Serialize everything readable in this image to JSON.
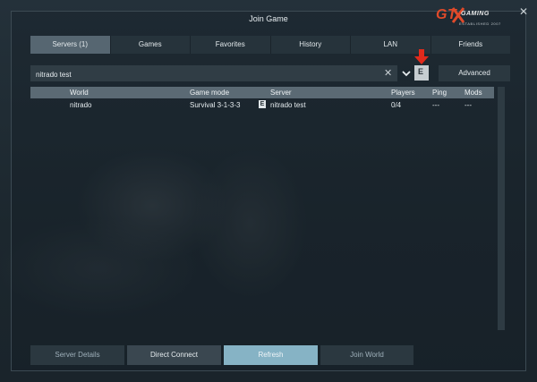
{
  "window": {
    "title": "Join Game"
  },
  "logo": {
    "brand": "GT",
    "sub": "GAMING",
    "tagline": "ESTABLISHED 2007"
  },
  "tabs": [
    {
      "label": "Servers (1)",
      "active": true
    },
    {
      "label": "Games"
    },
    {
      "label": "Favorites"
    },
    {
      "label": "History"
    },
    {
      "label": "LAN"
    },
    {
      "label": "Friends"
    }
  ],
  "search": {
    "value": "nitrado test",
    "placeholder": ""
  },
  "filter": {
    "epic_label": "E",
    "advanced_label": "Advanced"
  },
  "table": {
    "headers": {
      "world": "World",
      "mode": "Game mode",
      "server": "Server",
      "players": "Players",
      "ping": "Ping",
      "mods": "Mods"
    },
    "rows": [
      {
        "world": "nitrado",
        "mode": "Survival 3-1-3-3",
        "platform": "E",
        "server": "nitrado test",
        "players": "0/4",
        "ping": "---",
        "mods": "---"
      }
    ]
  },
  "buttons": {
    "server_details": "Server Details",
    "direct_connect": "Direct Connect",
    "refresh": "Refresh",
    "join_world": "Join World"
  },
  "colors": {
    "accent": "#86b3c5",
    "active_tab": "#566671",
    "highlight_arrow": "#e02a1c",
    "logo": "#e04a2a"
  }
}
